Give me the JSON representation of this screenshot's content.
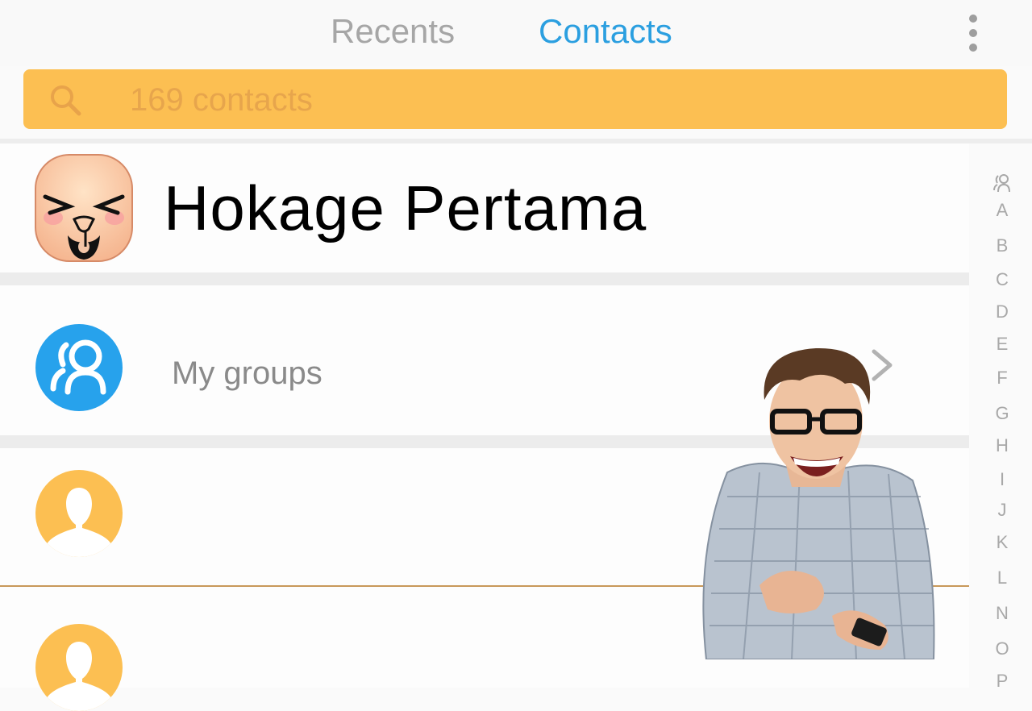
{
  "tabs": {
    "recents": "Recents",
    "contacts": "Contacts"
  },
  "search": {
    "placeholder": "169 contacts",
    "value": ""
  },
  "profile": {
    "name": "Hokage Pertama"
  },
  "groups": {
    "label": "My groups"
  },
  "alphabet": [
    "A",
    "B",
    "C",
    "D",
    "E",
    "F",
    "G",
    "H",
    "I",
    "J",
    "K",
    "L",
    "N",
    "O",
    "P"
  ],
  "colors": {
    "accent_blue": "#2b9fe0",
    "search_bg": "#fcbf52",
    "contact_avatar": "#fcbf52",
    "groups_avatar": "#27a2ec"
  },
  "icons": {
    "menu": "more-vert-icon",
    "search": "search-icon",
    "groups": "groups-icon",
    "contact": "person-icon",
    "chevron": "chevron-right-icon"
  }
}
